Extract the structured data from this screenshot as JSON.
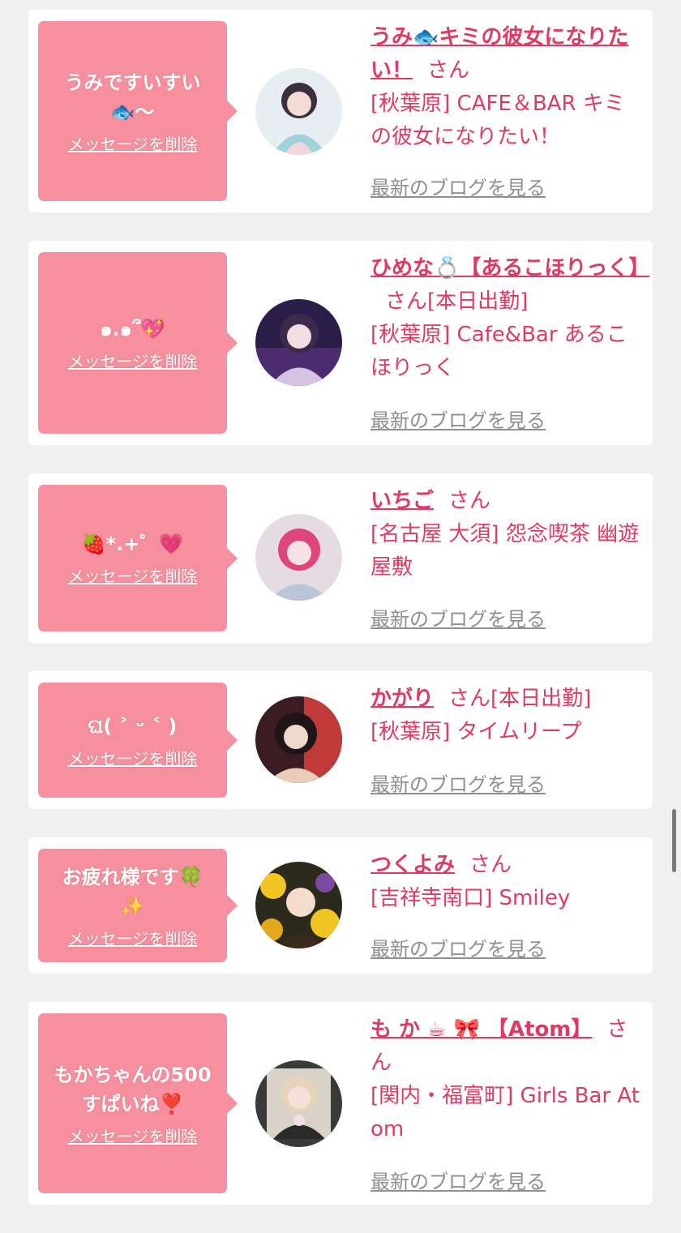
{
  "cards": [
    {
      "message": "うみですいすい🐟〜",
      "delete_label": "メッセージを削除",
      "name": "うみ🐟キミの彼女になりたい！",
      "san": "さん",
      "status": "",
      "shop": "[秋葉原] CAFE＆BAR キミの彼女になりたい！",
      "blog_label": "最新のブログを見る",
      "avatar_colors": [
        "#dfe9ee",
        "#9fd3dc",
        "#f3d6dd"
      ]
    },
    {
      "message": "๑.๑՞💖",
      "delete_label": "メッセージを削除",
      "name": "ひめな💍【あるこほりっく】",
      "san": "さん",
      "status": "[本日出勤]",
      "shop": "[秋葉原] Cafe&Bar あるこほりっく",
      "blog_label": "最新のブログを見る",
      "avatar_colors": [
        "#2a1d4a",
        "#6e3b8e",
        "#d6c3e4"
      ]
    },
    {
      "message": "🍓*.+゜💗",
      "delete_label": "メッセージを削除",
      "name": "いちご",
      "san": "さん",
      "status": "",
      "shop": "[名古屋 大須] 怨念喫茶 幽遊屋敷",
      "blog_label": "最新のブログを見る",
      "avatar_colors": [
        "#e4dce2",
        "#e0457a",
        "#b8c6d8"
      ]
    },
    {
      "message": "ଘ( ˃ ᵕ ˂ )",
      "delete_label": "メッセージを削除",
      "name": "かがり",
      "san": "さん",
      "status": "[本日出勤]",
      "shop": "[秋葉原] タイムリープ",
      "blog_label": "最新のブログを見る",
      "avatar_colors": [
        "#3b1c22",
        "#c13a3a",
        "#e8cdb8"
      ]
    },
    {
      "message": "お疲れ様です🍀✨",
      "delete_label": "メッセージを削除",
      "name": "つくよみ",
      "san": "さん",
      "status": "",
      "shop": "[吉祥寺南口] Smiley",
      "blog_label": "最新のブログを見る",
      "avatar_colors": [
        "#2c2a1c",
        "#f2c522",
        "#7b4aa0"
      ]
    },
    {
      "message": "もかちゃんの500すぱいね❣️",
      "delete_label": "メッセージを削除",
      "name": "も か ☕ 🎀 【Atom】",
      "san": "さん",
      "status": "",
      "shop": "[関内・福富町] Girls Bar Atom",
      "blog_label": "最新のブログを見る",
      "avatar_colors": [
        "#d9d2c8",
        "#3a3a3a",
        "#f1dede"
      ]
    }
  ]
}
